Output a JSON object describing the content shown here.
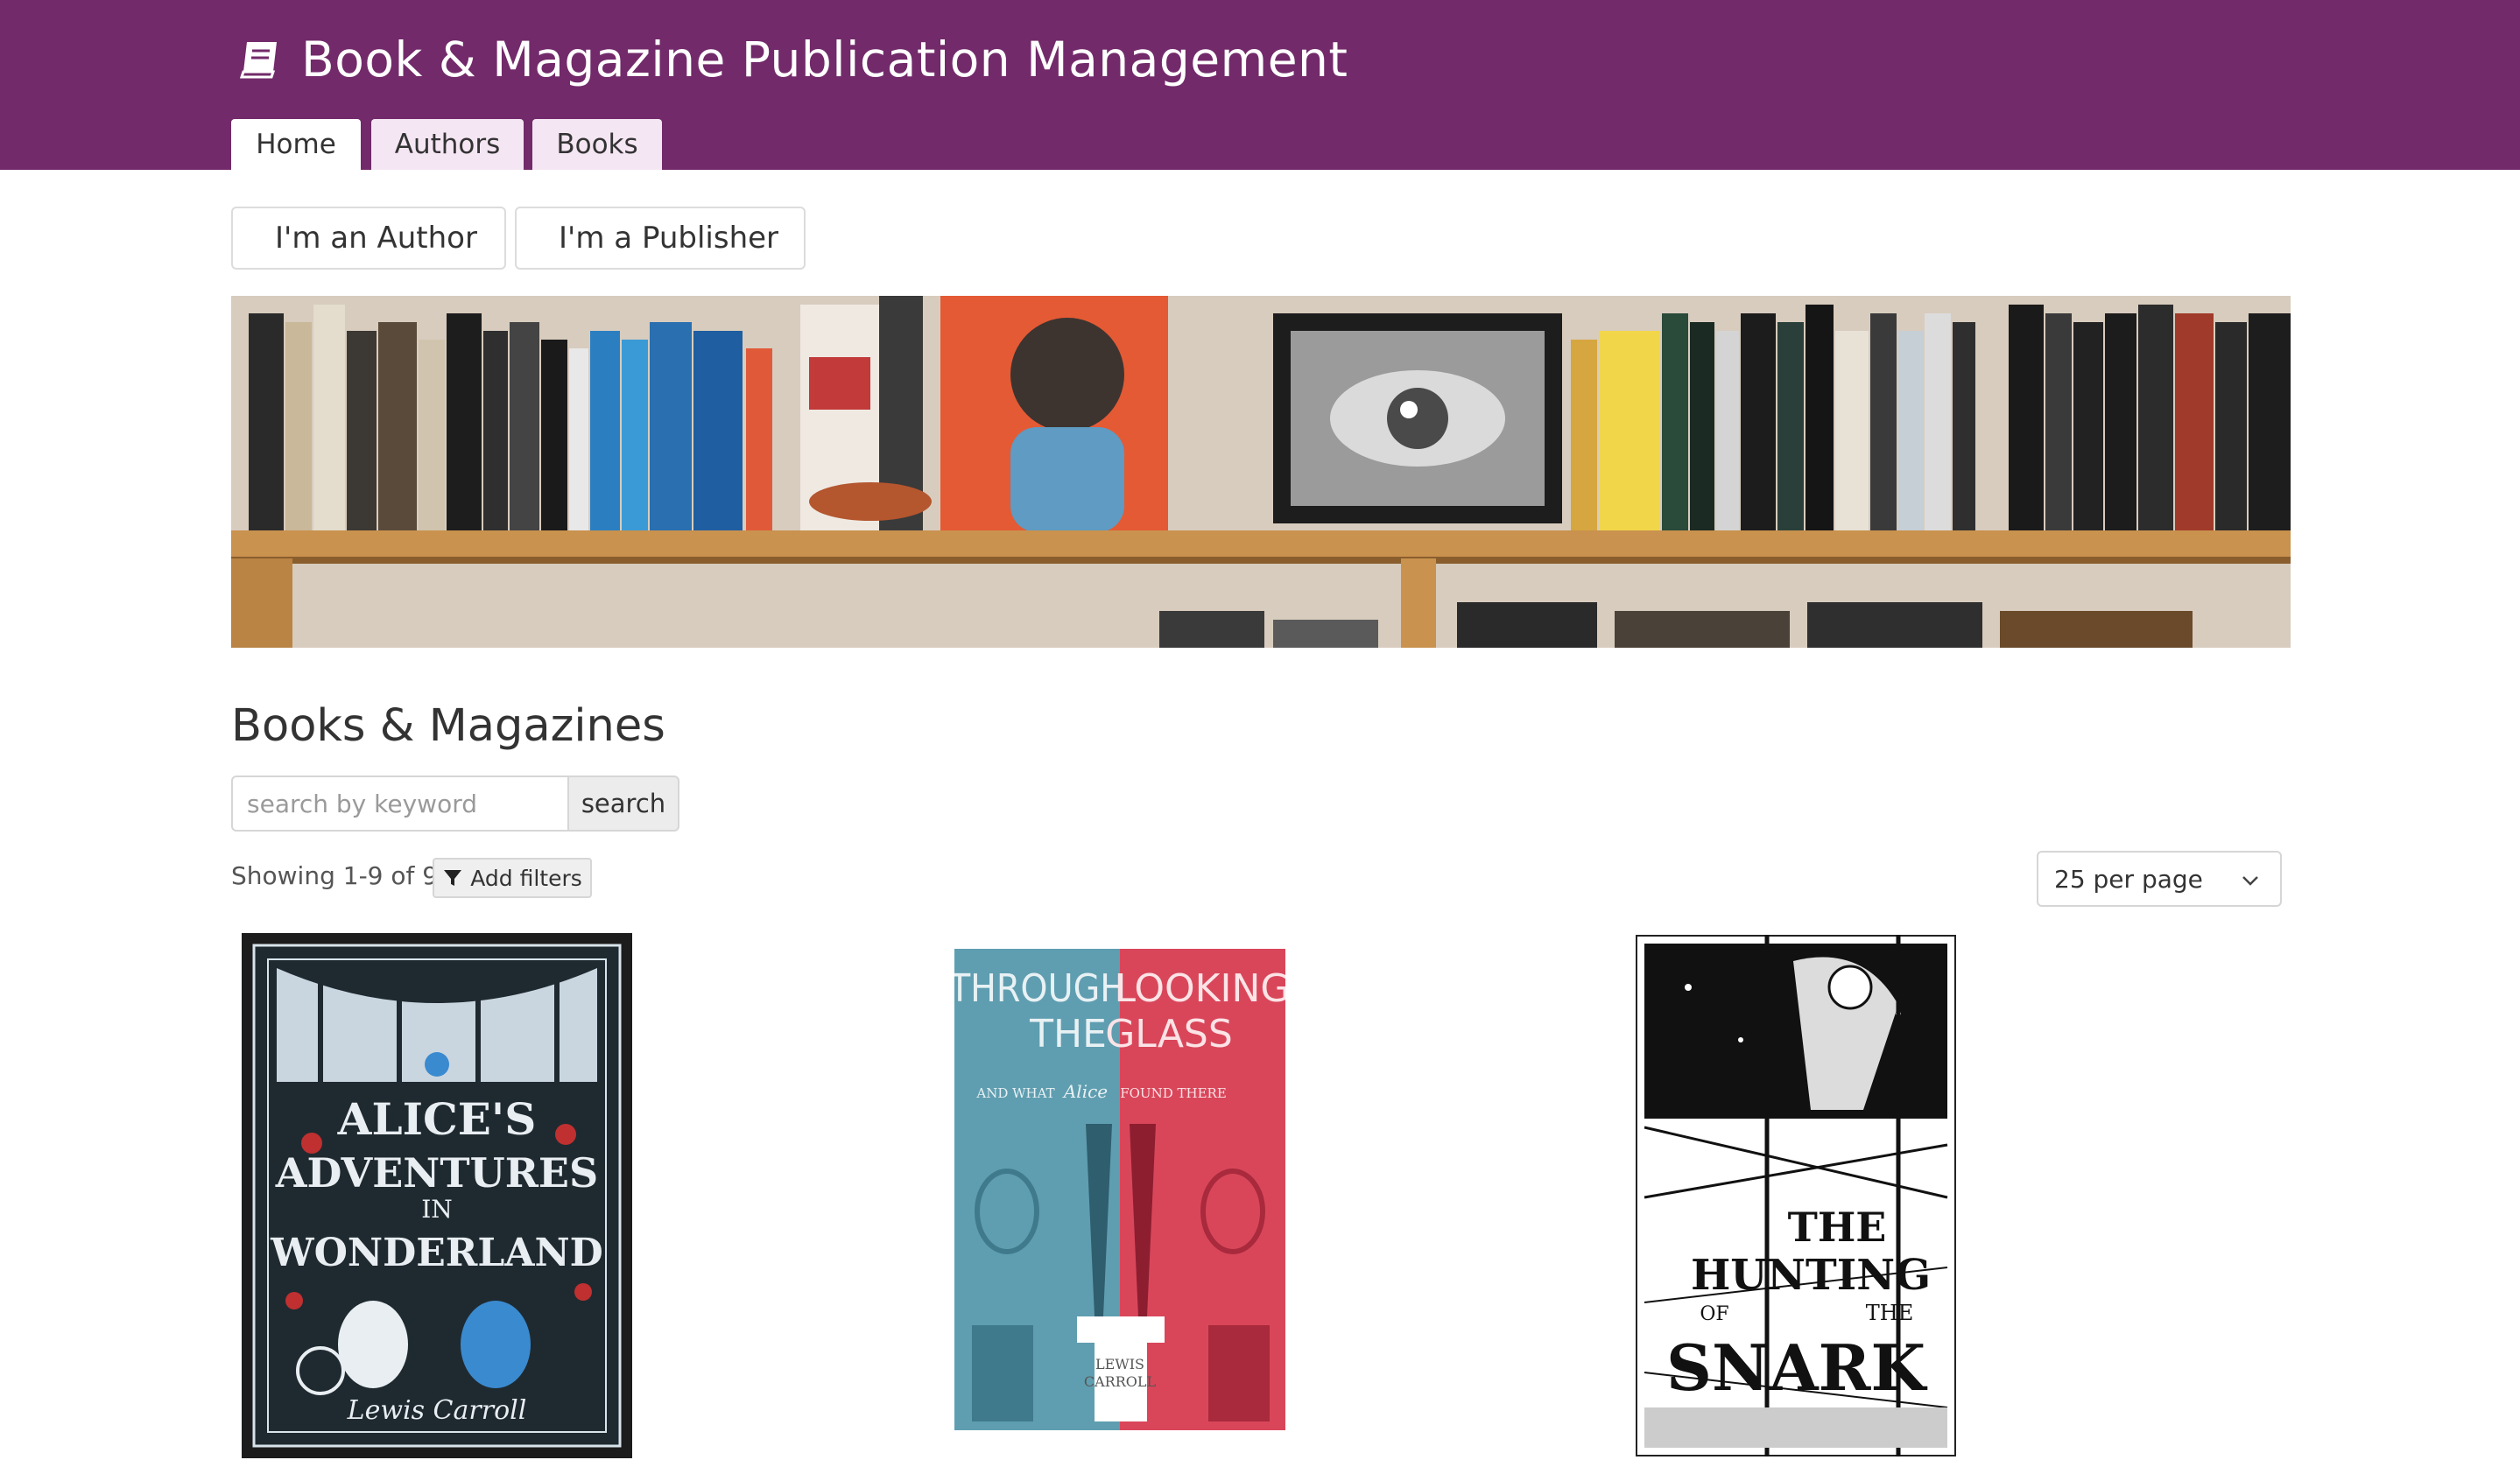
{
  "header": {
    "title": "Book & Magazine Publication Management",
    "brand_color": "#722a6a",
    "tabs": [
      {
        "label": "Home",
        "active": true
      },
      {
        "label": "Authors",
        "active": false
      },
      {
        "label": "Books",
        "active": false
      }
    ]
  },
  "roles": {
    "author_label": "I'm an Author",
    "publisher_label": "I'm a Publisher"
  },
  "main": {
    "section_title": "Books & Magazines",
    "search": {
      "placeholder": "search by keyword",
      "button_label": "search"
    },
    "showing_text": "Showing 1-9 of 9",
    "filters_label": "Add filters",
    "per_page": "25 per page"
  },
  "books": [
    {
      "cover_text": [
        "ALICE'S",
        "ADVENTURES",
        "IN",
        "WONDERLAND"
      ],
      "author_script": "Lewis Carroll"
    },
    {
      "cover_left": [
        "THROUGH",
        "THE"
      ],
      "cover_right": [
        "LOOKING",
        "GLASS"
      ],
      "subtitle_left": "AND WHAT",
      "subtitle_mid": "Alice",
      "subtitle_right": "FOUND THERE",
      "author": [
        "LEWIS",
        "CARROLL"
      ]
    },
    {
      "cover_text": [
        "THE",
        "HUNTING",
        "OF",
        "THE",
        "SNARK"
      ]
    }
  ],
  "icons": [
    "book-icon",
    "user-icon",
    "filter-icon",
    "chevron-down-icon"
  ]
}
